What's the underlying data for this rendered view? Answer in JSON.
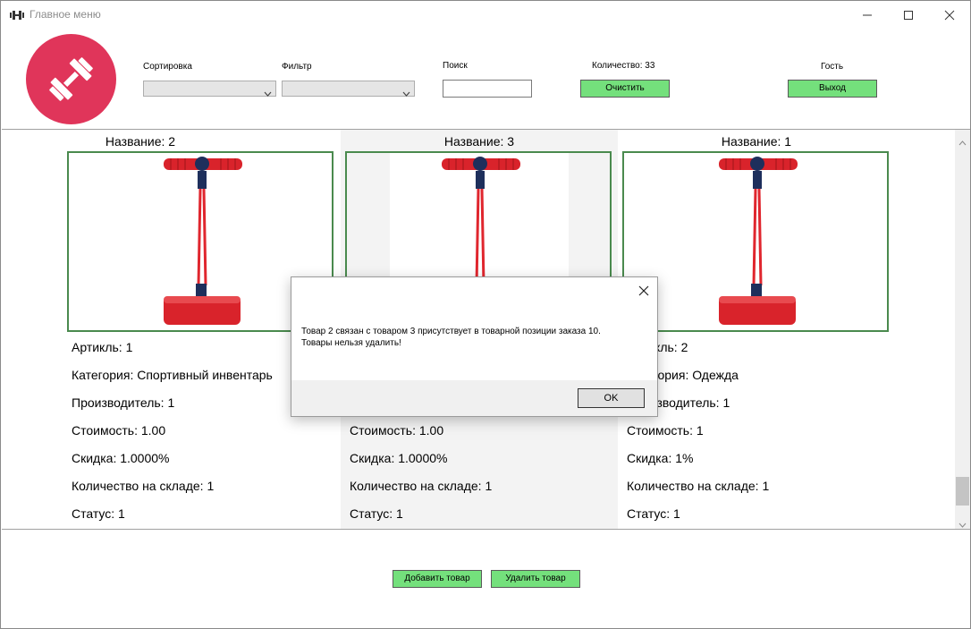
{
  "window": {
    "title": "Главное меню"
  },
  "header": {
    "sort_label": "Сортировка",
    "filter_label": "Фильтр",
    "search_label": "Поиск",
    "search_value": "",
    "count_label": "Количество: 33",
    "clear_button": "Очистить",
    "user_label": "Гость",
    "exit_button": "Выход",
    "sort_selected": "",
    "filter_selected": ""
  },
  "products": [
    {
      "name": "Название: 2",
      "article": "Артикль: 1",
      "category": "Категория: Спортивный инвентарь",
      "manufacturer": "Производитель: 1",
      "price": "Стоимость: 1.00",
      "discount": "Скидка: 1.0000%",
      "stock": "Количество на складе: 1",
      "status": "Статус: 1"
    },
    {
      "name": "Название: 3",
      "article": "",
      "category": "",
      "manufacturer": "",
      "price": "Стоимость: 1.00",
      "discount": "Скидка: 1.0000%",
      "stock": "Количество на складе: 1",
      "status": "Статус: 1"
    },
    {
      "name": "Название: 1",
      "article": "Артикль: 2",
      "category": "Категория: Одежда",
      "manufacturer": "Производитель: 1",
      "price": "Стоимость: 1",
      "discount": "Скидка: 1%",
      "stock": "Количество на складе: 1",
      "status": "Статус: 1"
    }
  ],
  "footer": {
    "add_button": "Добавить товар",
    "delete_button": "Удалить товар"
  },
  "dialog": {
    "message": "Товар 2 связан с товаром 3 присутствует в товарной позиции заказа 10.\n Товары нельзя удалить!",
    "ok_button": "OK"
  },
  "colors": {
    "logo": "#e0355a",
    "button_green": "#74e07c",
    "image_border": "#4a8a4e"
  },
  "icons": {
    "app": "dumbbell-icon",
    "logo": "dumbbell-logo-icon",
    "minimize": "minimize-icon",
    "maximize": "maximize-icon",
    "close": "close-icon"
  }
}
